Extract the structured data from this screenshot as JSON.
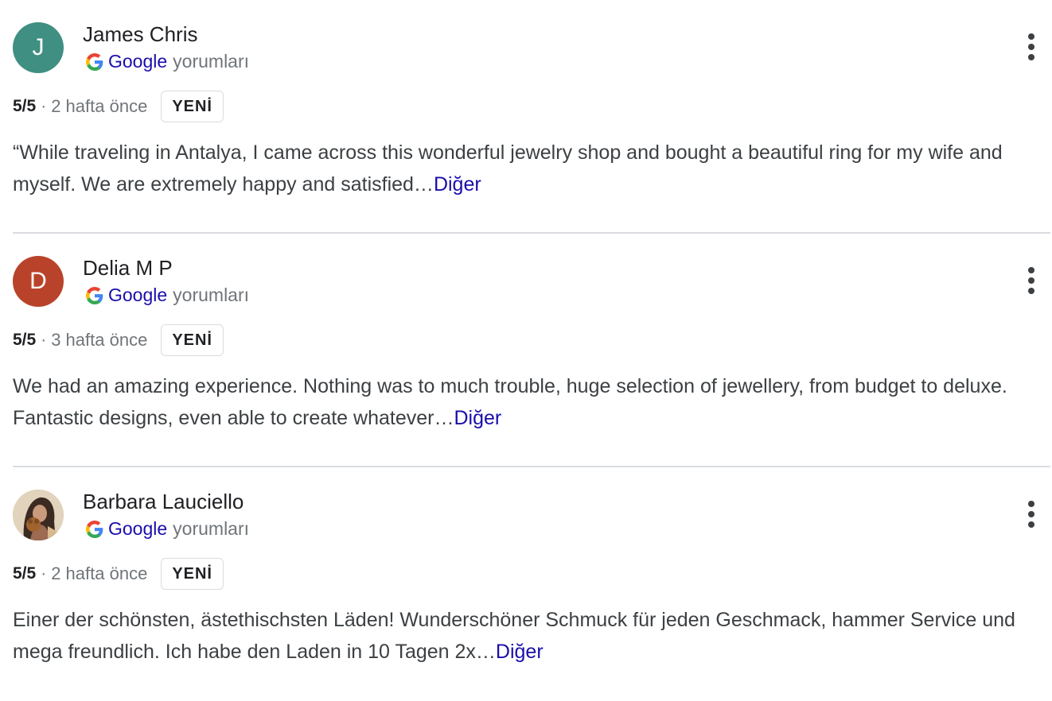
{
  "reviews": [
    {
      "author": "James Chris",
      "avatar_letter": "J",
      "avatar_color": "#3f8f82",
      "source_brand": "Google",
      "source_suffix": "yorumları",
      "rating": "5/5",
      "separator": "·",
      "time": "2 hafta önce",
      "badge": "YENİ",
      "text": "“While traveling in Antalya, I came across this wonderful jewelry shop and bought a beautiful ring for my wife and myself. We are extremely happy and satisfied…",
      "more_label": "Diğer"
    },
    {
      "author": "Delia M P",
      "avatar_letter": "D",
      "avatar_color": "#b9432a",
      "source_brand": "Google",
      "source_suffix": "yorumları",
      "rating": "5/5",
      "separator": "·",
      "time": "3 hafta önce",
      "badge": "YENİ",
      "text": "We had an amazing experience. Nothing was to much trouble, huge selection of jewellery, from budget to deluxe. Fantastic designs, even able to create whatever…",
      "more_label": "Diğer"
    },
    {
      "author": "Barbara Lauciello",
      "avatar_icon": "profile-photo",
      "source_brand": "Google",
      "source_suffix": "yorumları",
      "rating": "5/5",
      "separator": "·",
      "time": "2 hafta önce",
      "badge": "YENİ",
      "text": "Einer der schönsten, ästethischsten Läden! Wunderschöner Schmuck für jeden Geschmack, hammer Service und mega freundlich. Ich habe den Laden in 10 Tagen 2x…",
      "more_label": "Diğer"
    }
  ],
  "icons": {
    "google": "google-g-icon",
    "menu": "more-vert-icon"
  },
  "colors": {
    "link": "#1a0dab",
    "divider": "#dadce0",
    "muted": "#70757a"
  }
}
